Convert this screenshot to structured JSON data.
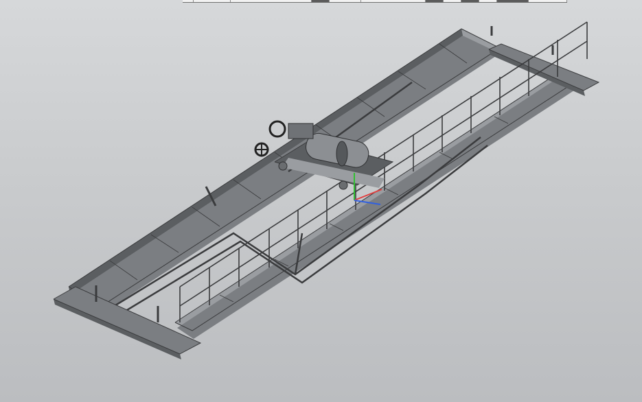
{
  "app": {
    "title": ""
  },
  "toolbar": {
    "segments": [
      {
        "name": "seg-1",
        "state": "normal"
      },
      {
        "name": "seg-2",
        "state": "normal"
      },
      {
        "name": "seg-3",
        "state": "normal"
      },
      {
        "name": "seg-4",
        "state": "active"
      },
      {
        "name": "seg-5",
        "state": "normal"
      },
      {
        "name": "seg-6",
        "state": "normal"
      },
      {
        "name": "seg-7",
        "state": "active"
      },
      {
        "name": "seg-8",
        "state": "normal"
      },
      {
        "name": "seg-9",
        "state": "active"
      },
      {
        "name": "seg-10",
        "state": "normal"
      },
      {
        "name": "seg-11",
        "state": "active"
      },
      {
        "name": "seg-12",
        "state": "normal"
      }
    ]
  },
  "model": {
    "subject": "overhead-crane-3d-model",
    "colors": {
      "steel_dark": "#5b5e61",
      "steel_mid": "#7b7e82",
      "steel_light": "#9a9da1",
      "axis_x": "#e04040",
      "axis_y": "#30c030",
      "axis_z": "#3060e0"
    },
    "icons": [
      "handwheel-icon",
      "motor-icon",
      "axis-triad-icon"
    ]
  }
}
